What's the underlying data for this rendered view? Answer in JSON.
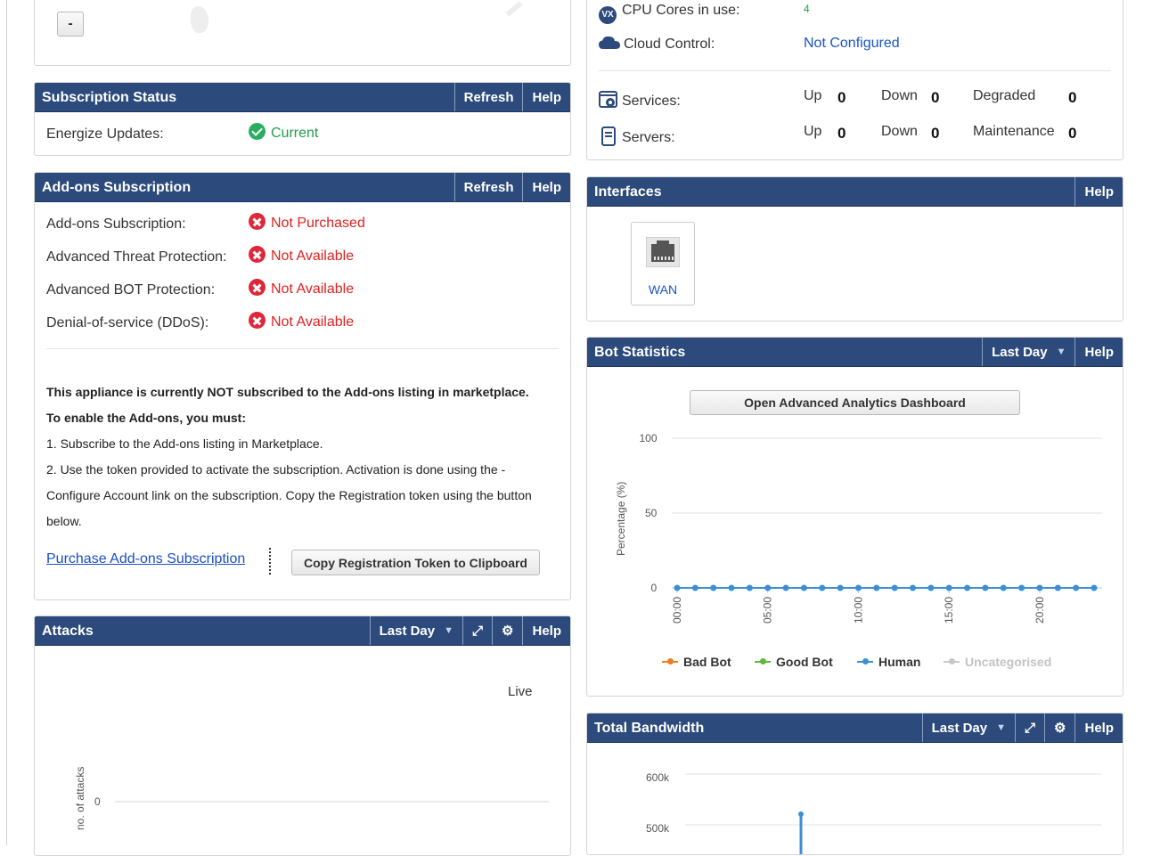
{
  "top_left_panel": {
    "minus_button": "-"
  },
  "system": {
    "cpu_label": "CPU Cores in use:",
    "cpu_value": "4",
    "cloud_label": "Cloud Control:",
    "cloud_value": "Not Configured",
    "services_label": "Services:",
    "servers_label": "Servers:",
    "up_label": "Up",
    "down_label": "Down",
    "degraded_label": "Degraded",
    "maintenance_label": "Maintenance",
    "services_up": "0",
    "services_down": "0",
    "services_degraded": "0",
    "servers_up": "0",
    "servers_down": "0",
    "servers_maintenance": "0"
  },
  "subscription": {
    "title": "Subscription Status",
    "refresh": "Refresh",
    "help": "Help",
    "energize_label": "Energize Updates:",
    "energize_value": "Current"
  },
  "addons": {
    "title": "Add-ons Subscription",
    "refresh": "Refresh",
    "help": "Help",
    "rows": [
      {
        "label": "Add-ons Subscription:",
        "value": "Not Purchased"
      },
      {
        "label": "Advanced Threat Protection:",
        "value": "Not Available"
      },
      {
        "label": "Advanced BOT Protection:",
        "value": "Not Available"
      },
      {
        "label": "Denial-of-service (DDoS):",
        "value": "Not Available"
      }
    ],
    "notice_line1": "This appliance is currently NOT subscribed to the Add-ons listing in marketplace.",
    "notice_line2": "To enable the Add-ons, you must:",
    "step1": "1. Subscribe to the Add-ons listing in Marketplace.",
    "step2a": "2. Use the token provided to activate the subscription. Activation is done using the -",
    "step2b": "Configure Account link on the subscription. Copy the Registration token using the button",
    "step2c": "below.",
    "purchase_link": "Purchase Add-ons Subscription",
    "copy_button": "Copy Registration Token to Clipboard"
  },
  "attacks": {
    "title": "Attacks",
    "range": "Last Day",
    "help": "Help",
    "live": "Live",
    "ylabel": "no. of attacks",
    "ytick": "0"
  },
  "interfaces": {
    "title": "Interfaces",
    "help": "Help",
    "wan": "WAN"
  },
  "bot": {
    "title": "Bot Statistics",
    "range": "Last Day",
    "help": "Help",
    "dashboard_button": "Open Advanced Analytics Dashboard",
    "ylabel": "Percentage (%)",
    "legend": [
      {
        "name": "Bad Bot",
        "color": "#f07d1e"
      },
      {
        "name": "Good Bot",
        "color": "#5fb83a"
      },
      {
        "name": "Human",
        "color": "#3b8fd6"
      },
      {
        "name": "Uncategorised",
        "color": "#c8c8c8"
      }
    ]
  },
  "bandwidth": {
    "title": "Total Bandwidth",
    "range": "Last Day",
    "help": "Help",
    "yticks": [
      "600k",
      "500k"
    ]
  },
  "chart_data": [
    {
      "type": "line",
      "ylabel": "Percentage (%)",
      "ylim": [
        0,
        100
      ],
      "yticks": [
        0,
        50,
        100
      ],
      "xticks": [
        "00:00",
        "05:00",
        "10:00",
        "15:00",
        "20:00"
      ],
      "series": [
        {
          "name": "Human",
          "values": [
            0,
            0,
            0,
            0,
            0,
            0,
            0,
            0,
            0,
            0,
            0,
            0,
            0,
            0,
            0,
            0,
            0,
            0,
            0,
            0,
            0,
            0,
            0,
            0
          ]
        }
      ]
    },
    {
      "type": "line",
      "ylabel": "no. of attacks",
      "yticks": [
        0
      ],
      "series": []
    },
    {
      "type": "line",
      "yticks": [
        "600k",
        "500k"
      ],
      "series": []
    }
  ]
}
